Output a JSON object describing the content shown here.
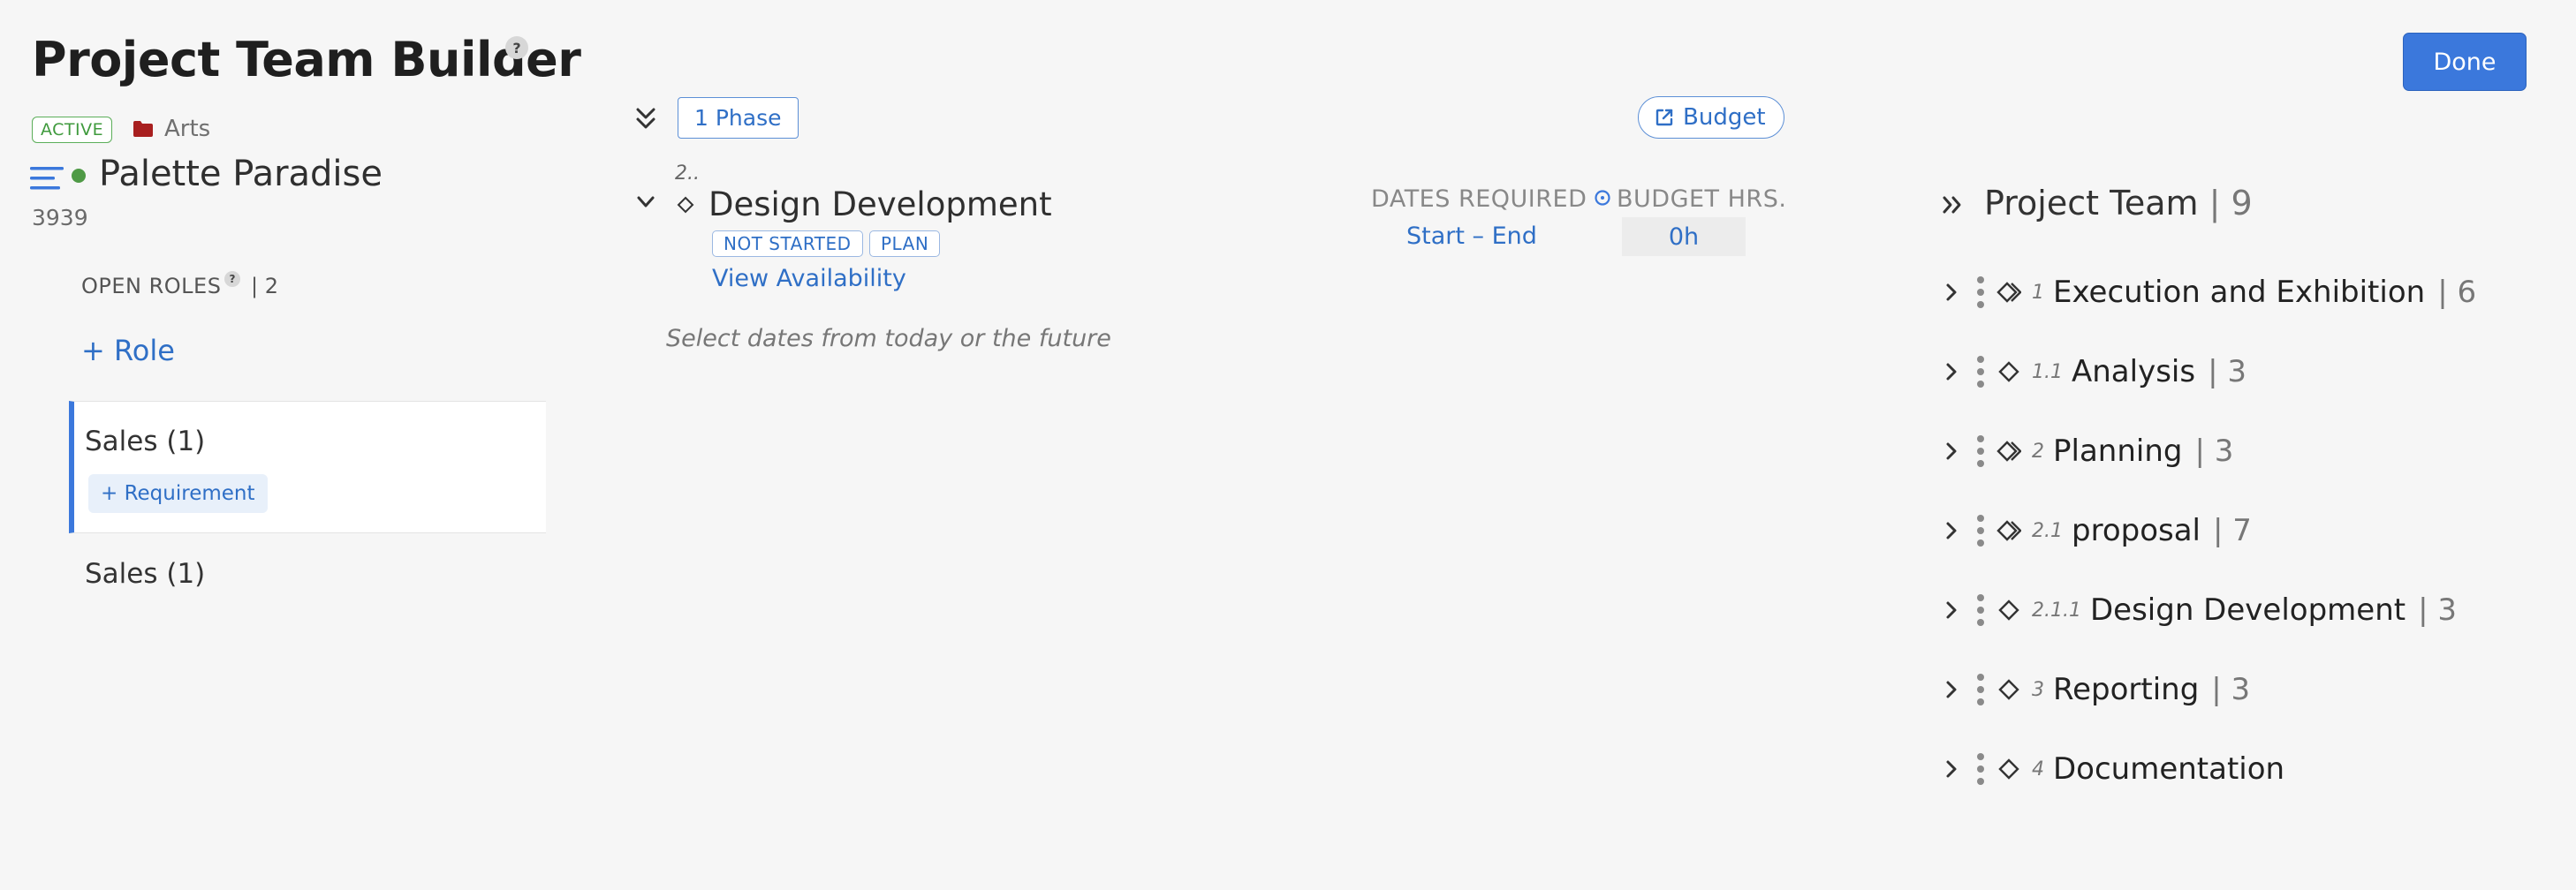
{
  "header": {
    "title": "Project Team Builder",
    "help_glyph": "?",
    "done_label": "Done"
  },
  "project": {
    "status": "ACTIVE",
    "folder": "Arts",
    "name": "Palette Paradise",
    "id": "3939"
  },
  "roles": {
    "heading": "OPEN ROLES",
    "help_glyph": "?",
    "count": "| 2",
    "add_role_label": "+ Role",
    "items": [
      {
        "title": "Sales (1)",
        "add_requirement_label": "+ Requirement"
      },
      {
        "title": "Sales (1)"
      }
    ]
  },
  "phase": {
    "phase_count_label": "1 Phase",
    "budget_label": "Budget",
    "number": "2..",
    "title": "Design Development",
    "status_badge": "NOT STARTED",
    "plan_badge": "PLAN",
    "view_availability": "View Availability",
    "hint": "Select dates from today or the future",
    "dates_required_label": "DATES REQUIRED",
    "dates_value": "Start  –  End",
    "budget_hours_label": "BUDGET HRS.",
    "budget_hours_value": "0h"
  },
  "team": {
    "title": "Project Team",
    "count": "| 9",
    "rows": [
      {
        "num": "1",
        "label": "Execution and Exhibition",
        "count": "| 6",
        "icon": "double-diamond-icon"
      },
      {
        "num": "1.1",
        "label": "Analysis",
        "count": "| 3",
        "icon": "diamond-icon"
      },
      {
        "num": "2",
        "label": "Planning",
        "count": "| 3",
        "icon": "double-diamond-icon"
      },
      {
        "num": "2.1",
        "label": "proposal",
        "count": "| 7",
        "icon": "double-diamond-icon"
      },
      {
        "num": "2.1.1",
        "label": "Design Development",
        "count": "| 3",
        "icon": "diamond-icon"
      },
      {
        "num": "3",
        "label": "Reporting",
        "count": "| 3",
        "icon": "diamond-icon"
      },
      {
        "num": "4",
        "label": "Documentation",
        "count": "",
        "icon": "diamond-icon"
      }
    ]
  },
  "colors": {
    "accent": "#3b78dc",
    "link": "#2f6fc6",
    "active_green": "#3f9a3d",
    "folder_red": "#a81f1f",
    "background": "#f6f6f6"
  }
}
